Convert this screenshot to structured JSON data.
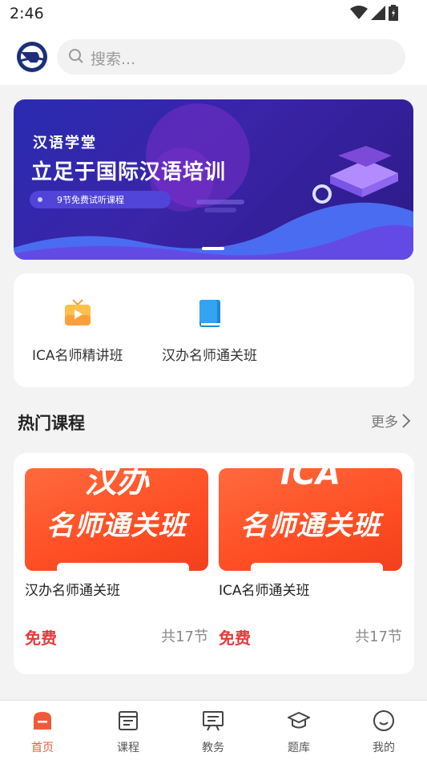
{
  "status_bar": {
    "time": "2:46"
  },
  "search": {
    "placeholder": "搜索..."
  },
  "banner": {
    "subtitle": "汉语学堂",
    "title": "立足于国际汉语培训",
    "pill": "9节免费试听课程"
  },
  "quick_nav": [
    {
      "label": "ICA名师精讲班",
      "icon": "tv-icon"
    },
    {
      "label": "汉办名师通关班",
      "icon": "book-icon"
    }
  ],
  "section": {
    "title": "热门课程",
    "more": "更多"
  },
  "courses": [
    {
      "thumb_line1": "汉办",
      "thumb_line2": "名师通关班",
      "name": "汉办名师通关班",
      "price": "免费",
      "lessons": "共17节"
    },
    {
      "thumb_line1": "ICA",
      "thumb_line2": "名师通关班",
      "name": "ICA名师通关班",
      "price": "免费",
      "lessons": "共17节"
    }
  ],
  "tabbar": [
    {
      "label": "首页",
      "icon": "home-icon",
      "active": true
    },
    {
      "label": "课程",
      "icon": "course-icon",
      "active": false
    },
    {
      "label": "教务",
      "icon": "board-icon",
      "active": false
    },
    {
      "label": "题库",
      "icon": "graduation-cap-icon",
      "active": false
    },
    {
      "label": "我的",
      "icon": "smile-icon",
      "active": false
    }
  ],
  "colors": {
    "accent": "#f05a3c",
    "price": "#e53b3b",
    "banner": "#2a2bb0"
  }
}
